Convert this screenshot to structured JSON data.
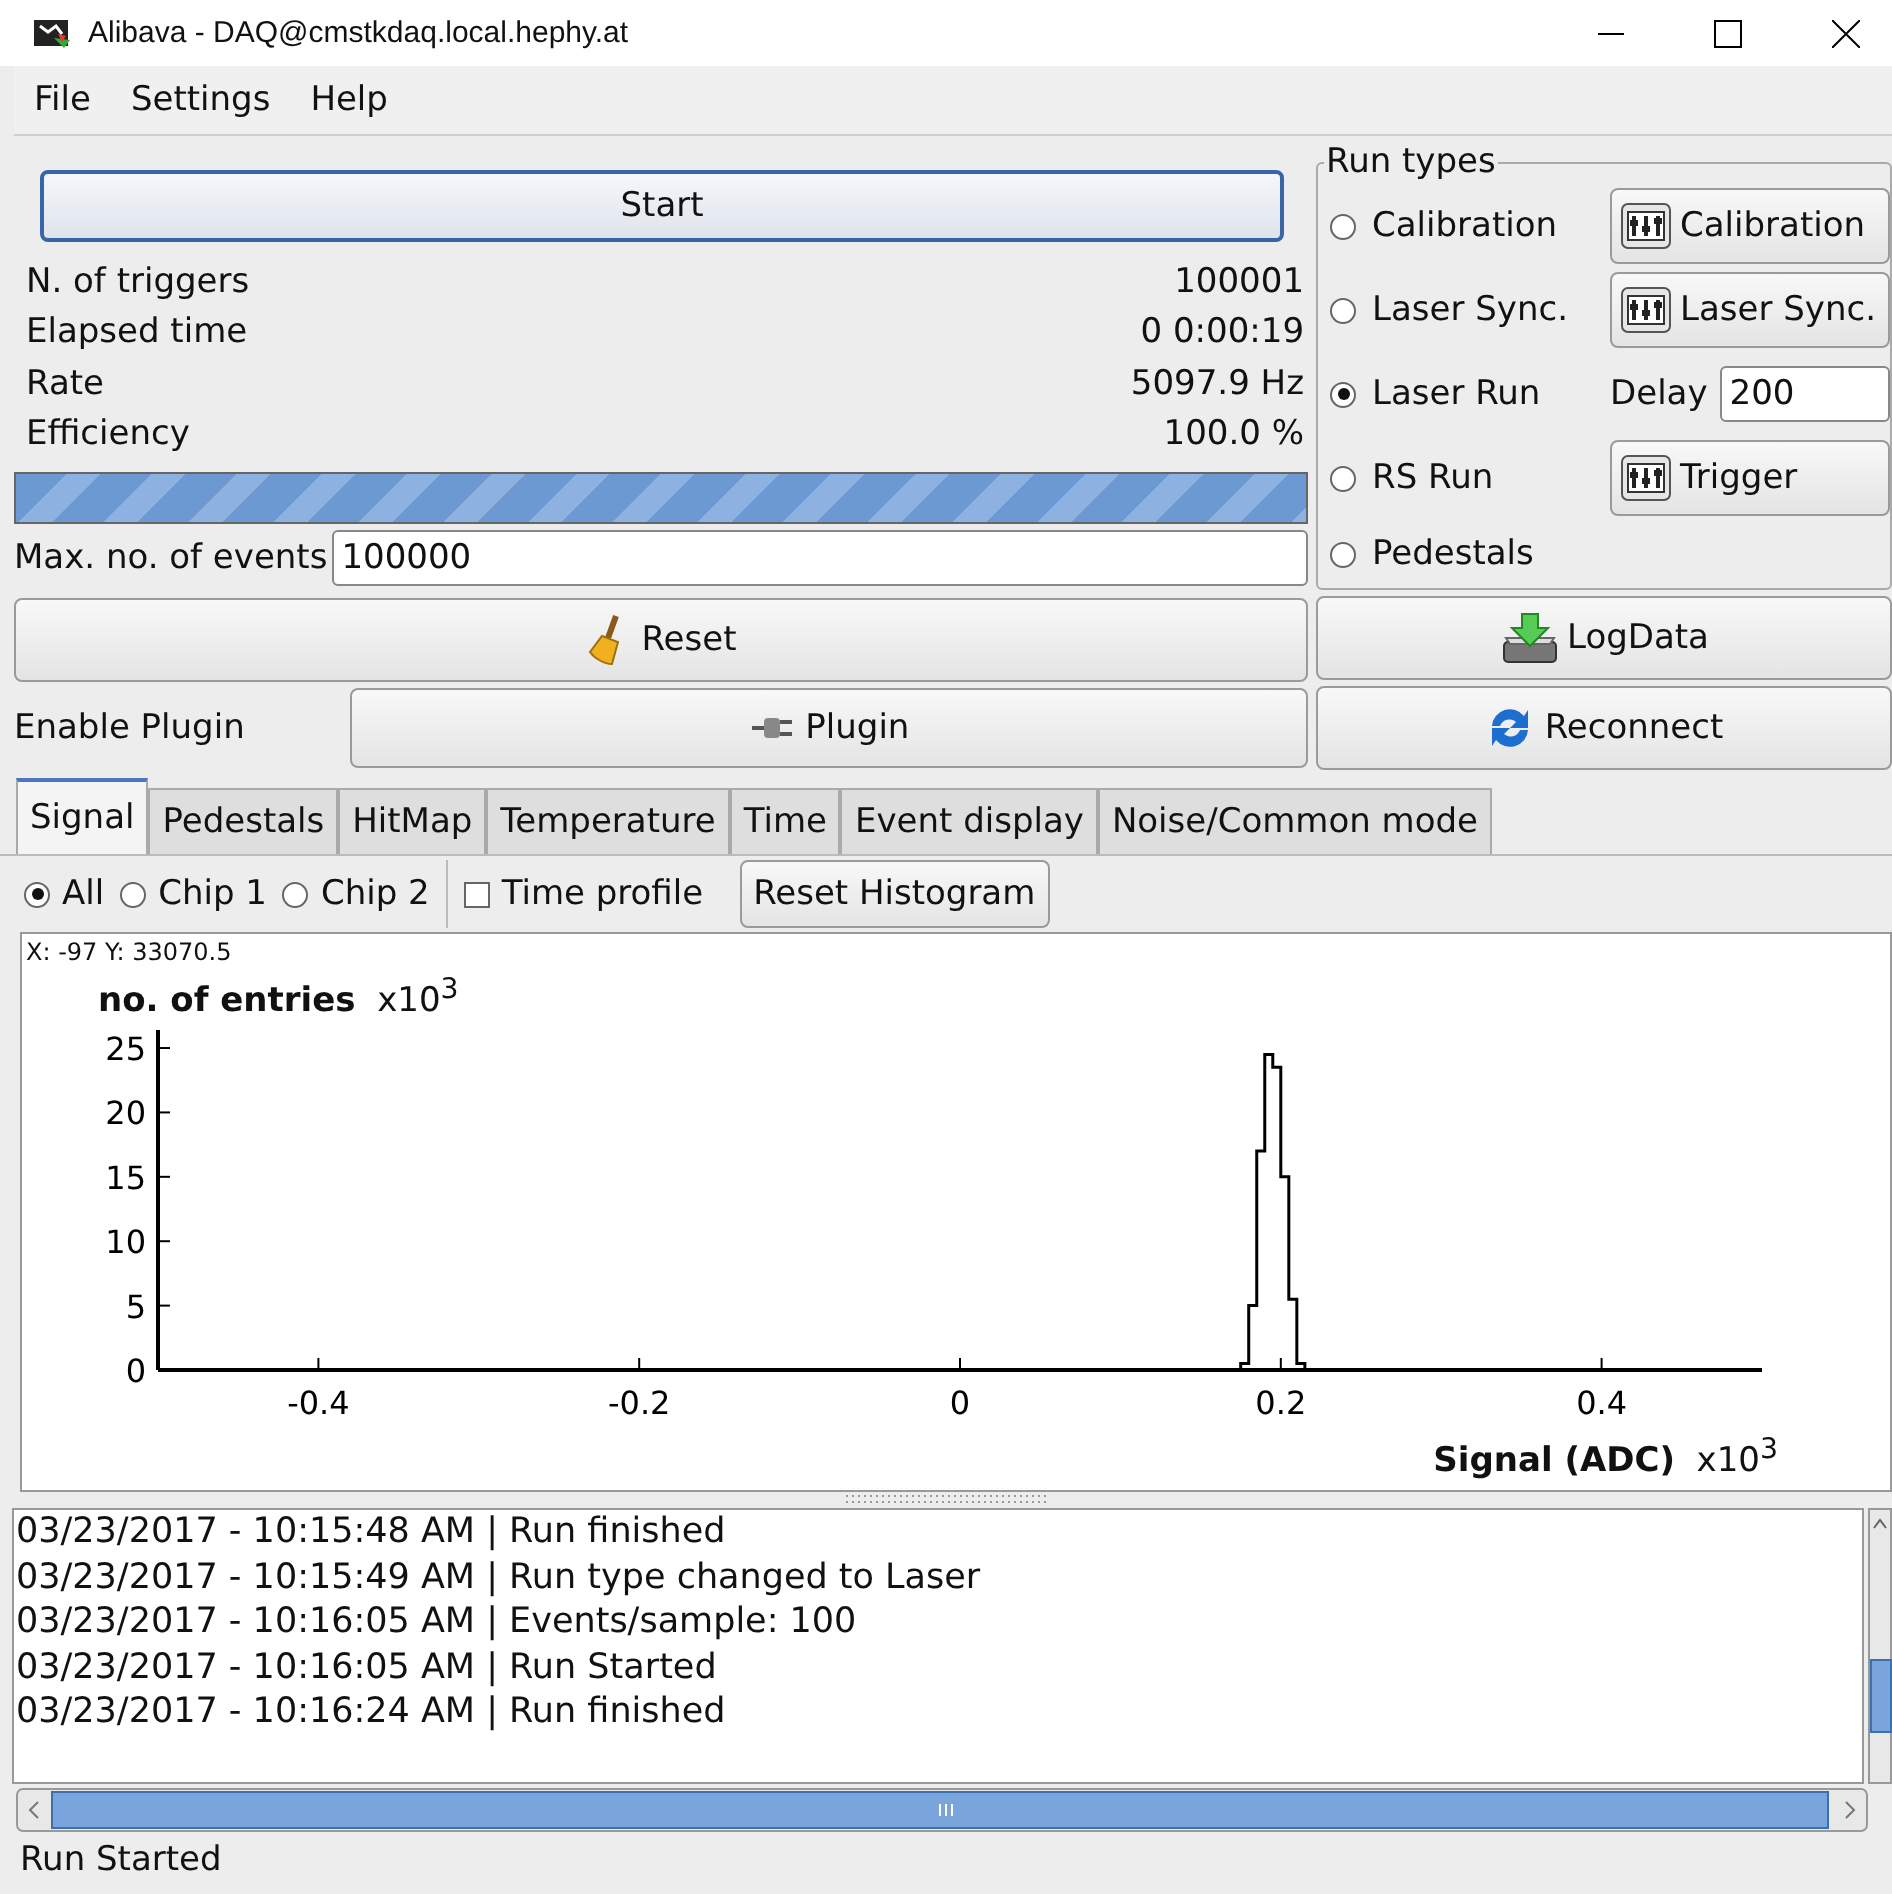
{
  "window": {
    "title": "Alibava - DAQ@cmstkdaq.local.hephy.at"
  },
  "menu": [
    "File",
    "Settings",
    "Help"
  ],
  "start_button": "Start",
  "stats": [
    {
      "label": "N. of triggers",
      "value": "100001"
    },
    {
      "label": "Elapsed time",
      "value": "0  0:00:19"
    },
    {
      "label": "Rate",
      "value": "5097.9 Hz"
    },
    {
      "label": "Efficiency",
      "value": "100.0 %"
    }
  ],
  "progress": {
    "level": 1
  },
  "max_events": {
    "label": "Max. no. of events",
    "value": "100000"
  },
  "reset_button": "Reset",
  "plugin": {
    "label": "Enable Plugin",
    "button": "Plugin"
  },
  "run_types": {
    "title": "Run types",
    "items": [
      {
        "label": "Calibration",
        "selected": false,
        "control": {
          "kind": "button",
          "label": "Calibration"
        }
      },
      {
        "label": "Laser Sync.",
        "selected": false,
        "control": {
          "kind": "button",
          "label": "Laser Sync."
        }
      },
      {
        "label": "Laser Run",
        "selected": true,
        "control": {
          "kind": "field",
          "label": "Delay",
          "value": "200"
        }
      },
      {
        "label": "RS Run",
        "selected": false,
        "control": {
          "kind": "button",
          "label": "Trigger"
        }
      },
      {
        "label": "Pedestals",
        "selected": false
      }
    ]
  },
  "logdata_button": "LogData",
  "reconnect_button": "Reconnect",
  "tabs": [
    {
      "label": "Signal",
      "selected": true
    },
    {
      "label": "Pedestals",
      "selected": false
    },
    {
      "label": "HitMap",
      "selected": false
    },
    {
      "label": "Temperature",
      "selected": false
    },
    {
      "label": "Time",
      "selected": false
    },
    {
      "label": "Event display",
      "selected": false
    },
    {
      "label": "Noise/Common mode",
      "selected": false
    }
  ],
  "chips": [
    {
      "label": "All",
      "selected": true
    },
    {
      "label": "Chip 1",
      "selected": false
    },
    {
      "label": "Chip 2",
      "selected": false
    }
  ],
  "time_profile": {
    "label": "Time profile",
    "checked": false
  },
  "reset_histogram_button": "Reset Histogram",
  "plot": {
    "cursor": "X: -97 Y: 33070.5",
    "y_multiplier": "x10$^{3}$",
    "x_multiplier": "x10$^{3}$",
    "chart_data": {
      "type": "line",
      "xlabel": "Signal (ADC)",
      "ylabel": "no. of entries",
      "xlim": [
        -0.5,
        0.5
      ],
      "ylim": [
        0,
        26.4
      ],
      "xticks": [
        -0.4,
        -0.2,
        0,
        0.2,
        0.4
      ],
      "yticks": [
        0,
        5,
        10,
        15,
        20,
        25
      ],
      "x": [
        0.1775,
        0.1825,
        0.1875,
        0.1925,
        0.1975,
        0.2025,
        0.2075,
        0.2125
      ],
      "series": [
        {
          "color": "#000000",
          "values": [
            0.5,
            5,
            17,
            24.5,
            23.5,
            15,
            5.5,
            0.5
          ]
        }
      ]
    }
  },
  "log": [
    "03/23/2017 - 10:15:48 AM | Run finished",
    "03/23/2017 - 10:15:49 AM | Run type changed to Laser",
    "03/23/2017 - 10:16:05 AM | Events/sample: 100",
    "03/23/2017 - 10:16:05 AM | Run Started",
    "03/23/2017 - 10:16:24 AM | Run finished"
  ],
  "status_bar": "Run Started"
}
